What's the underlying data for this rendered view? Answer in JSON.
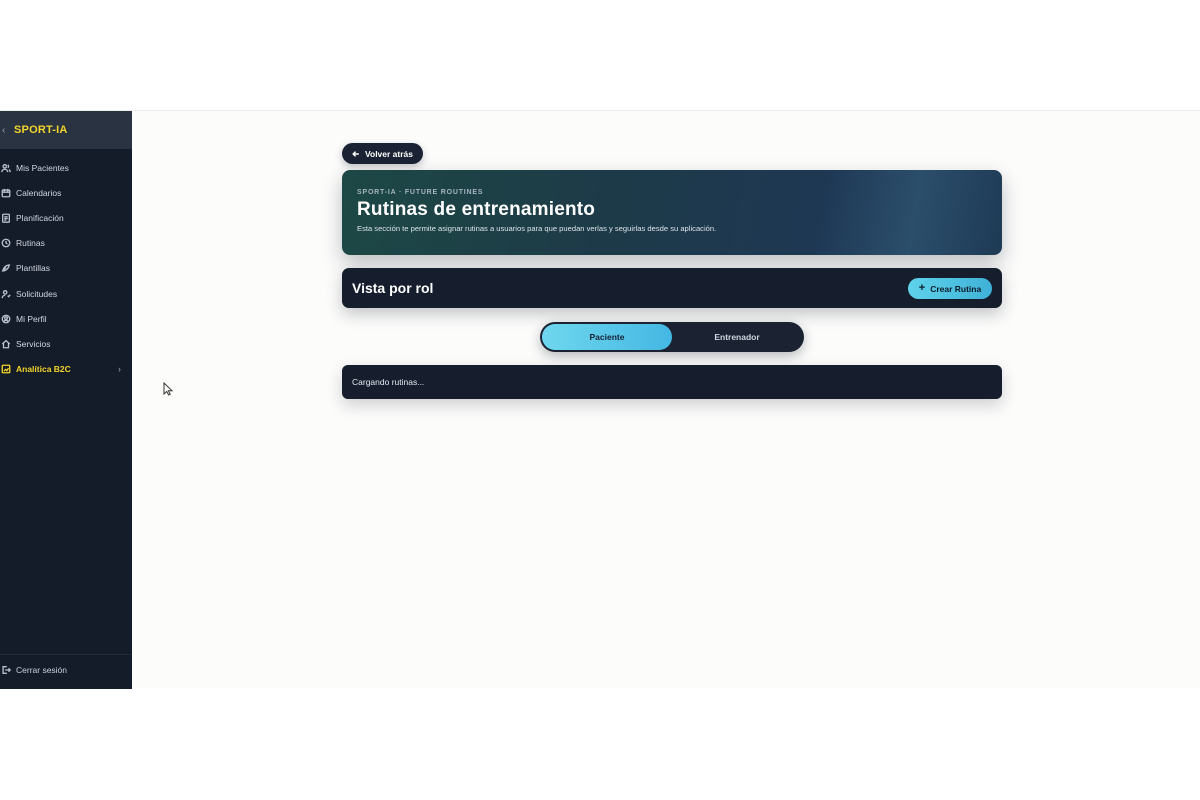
{
  "sidebar": {
    "brand": "SPORT-IA",
    "items": [
      {
        "label": "Mis Pacientes",
        "icon": "users-icon"
      },
      {
        "label": "Calendarios",
        "icon": "calendar-icon"
      },
      {
        "label": "Planificación",
        "icon": "planning-icon"
      },
      {
        "label": "Rutinas",
        "icon": "dumbbell-icon"
      },
      {
        "label": "Plantillas",
        "icon": "template-icon"
      },
      {
        "label": "Solicitudes",
        "icon": "requests-icon"
      },
      {
        "label": "Mi Perfil",
        "icon": "user-icon"
      },
      {
        "label": "Servicios",
        "icon": "services-icon"
      },
      {
        "label": "Analítica B2C",
        "icon": "analytics-icon"
      }
    ],
    "logout_label": "Cerrar sesión"
  },
  "main": {
    "back_label": "Volver atrás",
    "hero": {
      "eyebrow": "SPORT-IA · FUTURE ROUTINES",
      "title": "Rutinas de entrenamiento",
      "description": "Esta sección te permite asignar rutinas a usuarios para que puedan verlas y seguirlas desde su aplicación."
    },
    "role_view": {
      "label": "Vista por rol",
      "create_label": "Crear Rutina"
    },
    "toggle": {
      "options": [
        "Paciente",
        "Entrenador"
      ],
      "selected": "Paciente"
    },
    "loading_text": "Cargando rutinas..."
  },
  "colors": {
    "sidebar_bg": "#141b29",
    "accent_yellow": "#f3d52b",
    "accent_cyan": "#4fc3e6",
    "card_bg": "#161d2d"
  }
}
